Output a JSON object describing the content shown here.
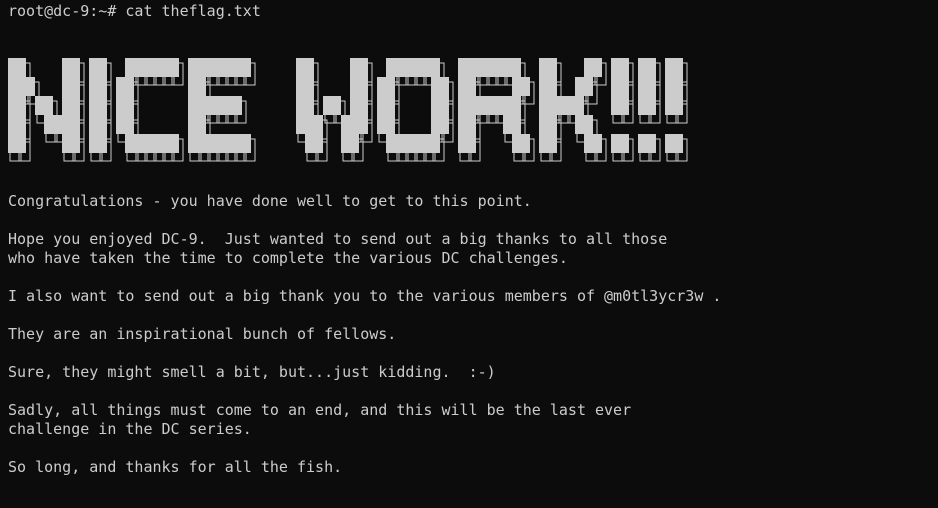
{
  "terminal": {
    "prompt": "root@dc-9:~# cat theflag.txt",
    "banner_text": "NICE WORK!!!",
    "lines": [
      "Congratulations - you have done well to get to this point.",
      "",
      "Hope you enjoyed DC-9.  Just wanted to send out a big thanks to all those",
      "who have taken the time to complete the various DC challenges.",
      "",
      "I also want to send out a big thank you to the various members of @m0tl3ycr3w .",
      "",
      "They are an inspirational bunch of fellows.",
      "",
      "Sure, they might smell a bit, but...just kidding.  :-)",
      "",
      "Sadly, all things must come to an end, and this will be the last ever",
      "challenge in the DC series.",
      "",
      "So long, and thanks for all the fish."
    ]
  },
  "colors": {
    "background": "#0c0c0c",
    "text": "#cccccc",
    "banner_fill": "#cccccc"
  }
}
